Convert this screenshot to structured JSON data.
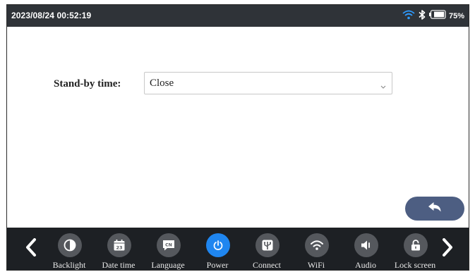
{
  "status_bar": {
    "datetime": "2023/08/24 00:52:19",
    "icons": [
      "wifi-icon",
      "bluetooth-icon",
      "battery-icon"
    ],
    "battery_percent": "75%"
  },
  "settings": {
    "standby_label": "Stand-by time:",
    "standby_value": "Close"
  },
  "back_button": {
    "icon": "back-arrow-icon"
  },
  "toolbar": {
    "items": [
      {
        "label": "Backlight",
        "icon": "contrast-icon"
      },
      {
        "label": "Date time",
        "icon": "calendar-icon",
        "icon_text": "23"
      },
      {
        "label": "Language",
        "icon": "language-icon",
        "icon_text": "CN"
      },
      {
        "label": "Power",
        "icon": "power-icon",
        "active": true
      },
      {
        "label": "Connect",
        "icon": "usb-icon"
      },
      {
        "label": "WiFi",
        "icon": "wifi-icon"
      },
      {
        "label": "Audio",
        "icon": "speaker-icon"
      },
      {
        "label": "Lock screen",
        "icon": "lock-icon"
      }
    ]
  },
  "colors": {
    "status_bar_bg": "#2f3338",
    "bottom_bar_bg": "#1d2024",
    "active_accent": "#1f86f0",
    "back_button_bg": "#4d5e82"
  }
}
